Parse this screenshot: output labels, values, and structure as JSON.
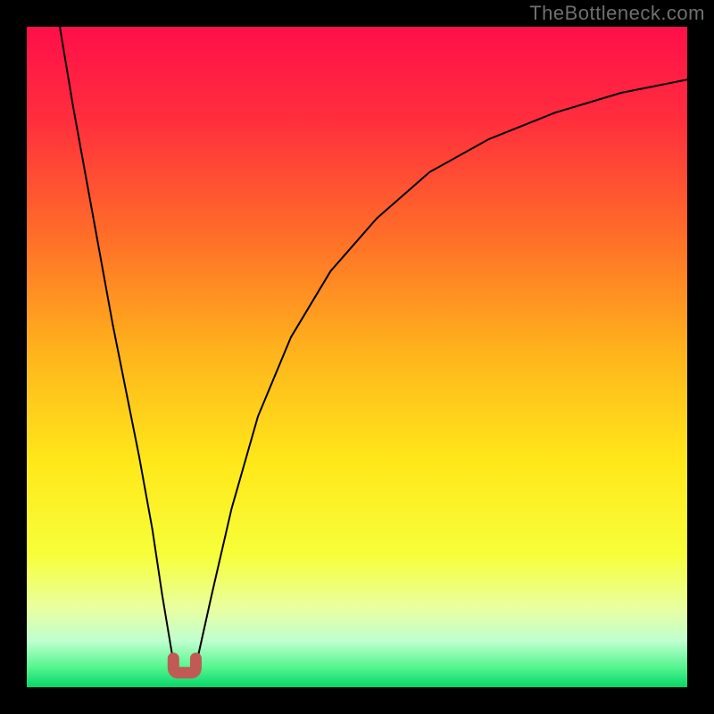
{
  "watermark": "TheBottleneck.com",
  "chart_data": {
    "type": "line",
    "title": "",
    "xlabel": "",
    "ylabel": "",
    "xlim": [
      0,
      100
    ],
    "ylim": [
      0,
      100
    ],
    "grid": false,
    "legend": false,
    "background": {
      "kind": "vertical-gradient",
      "stops": [
        {
          "y": 0,
          "color": "#ff0f4a"
        },
        {
          "y": 14,
          "color": "#ff2e3d"
        },
        {
          "y": 32,
          "color": "#ff6f28"
        },
        {
          "y": 50,
          "color": "#ffb61c"
        },
        {
          "y": 66,
          "color": "#ffe81a"
        },
        {
          "y": 80,
          "color": "#f7ff3a"
        },
        {
          "y": 88,
          "color": "#e9ffa0"
        },
        {
          "y": 93,
          "color": "#bfffcf"
        },
        {
          "y": 97,
          "color": "#55f58e"
        },
        {
          "y": 100,
          "color": "#06d66a"
        }
      ]
    },
    "series": [
      {
        "name": "bottleneck-curve",
        "stroke": "#000000",
        "stroke_width": 2,
        "x": [
          5,
          7,
          9,
          11,
          13,
          15,
          17,
          19,
          20.5,
          22,
          23,
          24,
          25,
          26,
          28,
          31,
          35,
          40,
          46,
          53,
          61,
          70,
          80,
          90,
          100
        ],
        "y": [
          100,
          88,
          77,
          66,
          55,
          45,
          35,
          24,
          14,
          5,
          2,
          1.5,
          2,
          5,
          14,
          27,
          41,
          53,
          63,
          71,
          78,
          83,
          87,
          90,
          92
        ]
      }
    ],
    "marker": {
      "name": "optimal-range",
      "shape": "u",
      "color": "#c05a55",
      "stroke_width": 13,
      "x_range": [
        22.2,
        25.6
      ],
      "y": 2.2
    }
  }
}
